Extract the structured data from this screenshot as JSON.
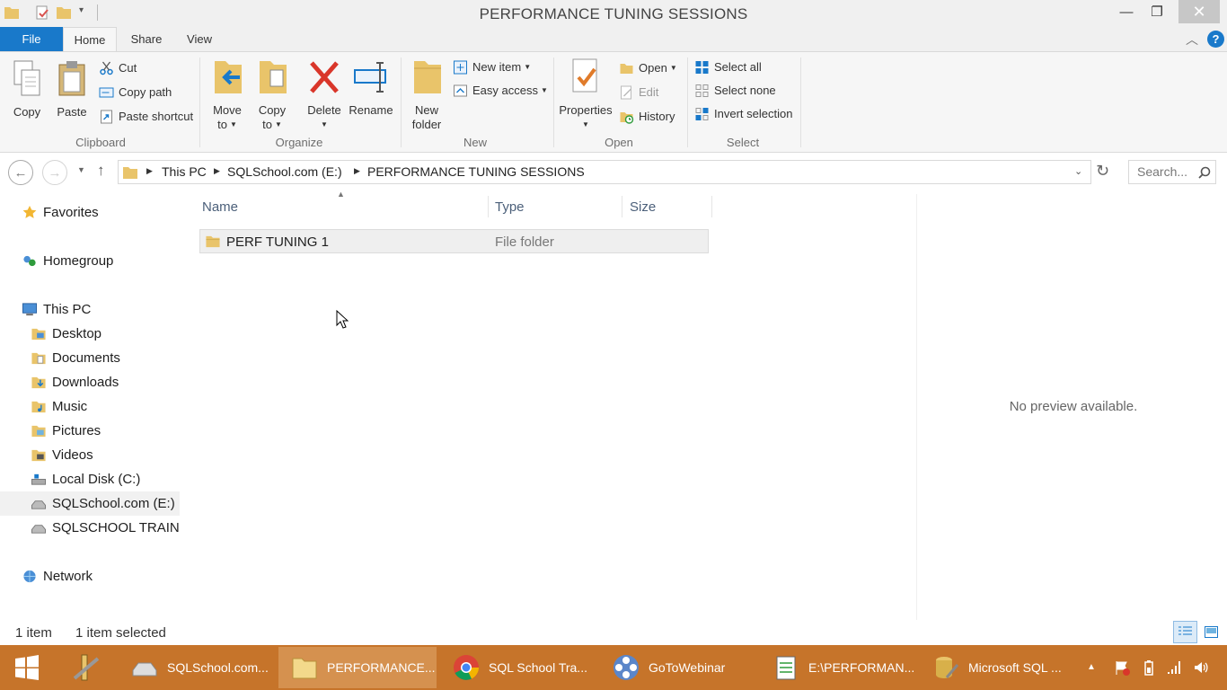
{
  "window": {
    "title": "PERFORMANCE TUNING SESSIONS",
    "minimize": "—",
    "maximize": "❐",
    "close": "✕",
    "help": "?"
  },
  "ribbon_tabs": [
    "File",
    "Home",
    "Share",
    "View"
  ],
  "clipboard": {
    "copy": "Copy",
    "paste": "Paste",
    "cut": "Cut",
    "copy_path": "Copy path",
    "paste_shortcut": "Paste shortcut",
    "label": "Clipboard"
  },
  "organize": {
    "move_to": [
      "Move",
      "to"
    ],
    "copy_to": [
      "Copy",
      "to"
    ],
    "delete": "Delete",
    "rename": "Rename",
    "label": "Organize"
  },
  "new_group": {
    "new_folder": [
      "New",
      "folder"
    ],
    "new_item": "New item",
    "easy_access": "Easy access",
    "label": "New"
  },
  "open_group": {
    "properties": "Properties",
    "open": "Open",
    "edit": "Edit",
    "history": "History",
    "label": "Open"
  },
  "select_group": {
    "select_all": "Select all",
    "select_none": "Select none",
    "invert_selection": "Invert selection",
    "label": "Select"
  },
  "address": {
    "crumbs": [
      "This PC",
      "SQLSchool.com (E:)",
      "PERFORMANCE TUNING SESSIONS"
    ],
    "search_placeholder": "Search..."
  },
  "nav_pane": {
    "favorites": "Favorites",
    "homegroup": "Homegroup",
    "this_pc": "This PC",
    "items": [
      "Desktop",
      "Documents",
      "Downloads",
      "Music",
      "Pictures",
      "Videos",
      "Local Disk (C:)",
      "SQLSchool.com (E:)",
      "SQLSCHOOL TRAININ"
    ],
    "network": "Network"
  },
  "file_list": {
    "columns": [
      "Name",
      "Type",
      "Size"
    ],
    "rows": [
      {
        "name": "PERF TUNING 1",
        "type": "File folder",
        "size": ""
      }
    ]
  },
  "preview": {
    "text": "No preview available."
  },
  "status": {
    "count": "1 item",
    "selected": "1 item selected"
  },
  "taskbar": {
    "items": [
      "SQLSchool.com...",
      "PERFORMANCE...",
      "SQL School Tra...",
      "GoToWebinar",
      "E:\\PERFORMAN...",
      "Microsoft SQL ..."
    ]
  },
  "colors": {
    "accent": "#1979ca",
    "taskbar": "#c6742a",
    "folder": "#e9c46a"
  }
}
